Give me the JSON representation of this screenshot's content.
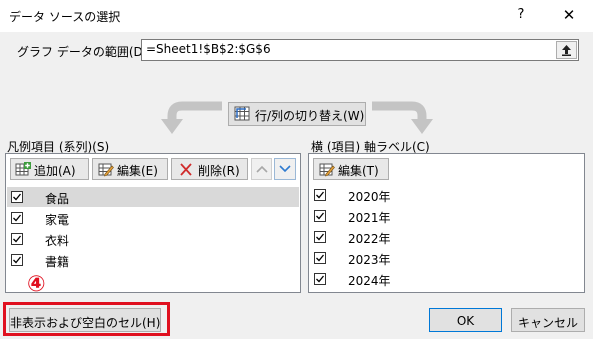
{
  "window": {
    "title": "データ ソースの選択",
    "help_glyph": "?",
    "close_glyph": "✕"
  },
  "range": {
    "label": "グラフ データの範囲(D):",
    "value": "=Sheet1!$B$2:$G$6"
  },
  "switch_button_label": "行/列の切り替え(W)",
  "legend_panel": {
    "label": "凡例項目 (系列)(S)",
    "add_label": "追加(A)",
    "edit_label": "編集(E)",
    "delete_label": "削除(R)",
    "items": [
      "食品",
      "家電",
      "衣料",
      "書籍"
    ]
  },
  "axis_panel": {
    "label": "横 (項目) 軸ラベル(C)",
    "edit_label": "編集(T)",
    "items": [
      "2020年",
      "2021年",
      "2022年",
      "2023年",
      "2024年"
    ]
  },
  "annotation_number": "④",
  "buttons": {
    "hidden_cells": "非表示および空白のセル(H)",
    "ok": "OK",
    "cancel": "キャンセル"
  },
  "colors": {
    "highlight_red": "#e0101f",
    "selected_row": "#cce8ff",
    "ok_border": "#0078d7"
  }
}
